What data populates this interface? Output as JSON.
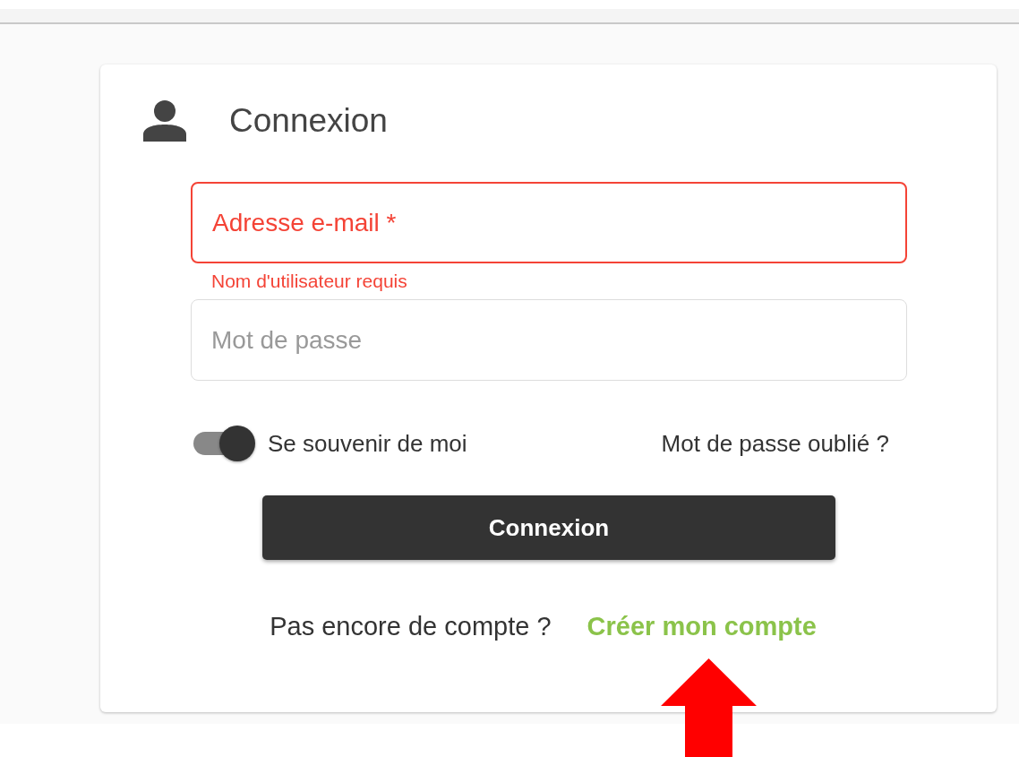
{
  "card": {
    "title": "Connexion"
  },
  "fields": [
    {
      "placeholder": "Adresse e-mail *",
      "error": true,
      "message": "Nom d'utilisateur requis"
    },
    {
      "placeholder": "Mot de passe",
      "error": false
    }
  ],
  "remember": {
    "label": "Se souvenir de moi",
    "on": true
  },
  "forgot_link": "Mot de passe oublié ?",
  "submit_button": "Connexion",
  "signup": {
    "prompt": "Pas encore de compte ?",
    "link": "Créer mon compte"
  },
  "annotation": {
    "kind": "arrow"
  }
}
